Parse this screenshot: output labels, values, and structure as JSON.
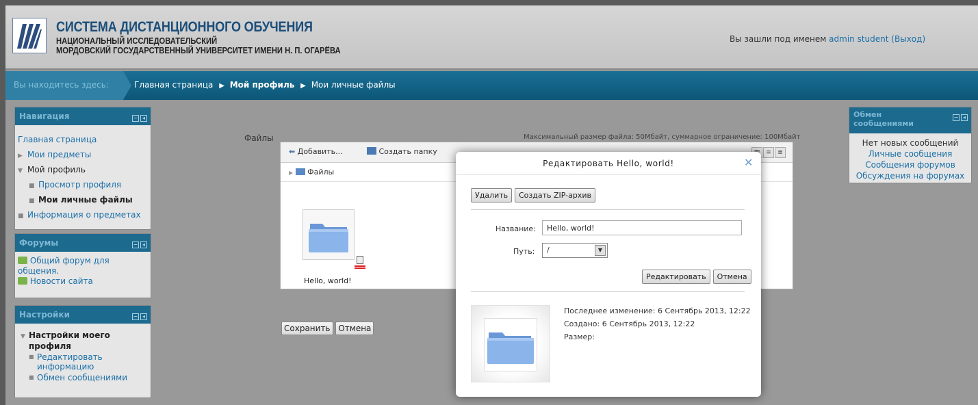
{
  "header": {
    "title": "СИСТЕМА ДИСТАНЦИОННОГО ОБУЧЕНИЯ",
    "subtitle1": "НАЦИОНАЛЬНЫЙ ИССЛЕДОВАТЕЛЬСКИЙ",
    "subtitle2": "МОРДОВСКИЙ ГОСУДАРСТВЕННЫЙ УНИВЕРСИТЕТ ИМЕНИ Н. П. ОГАРЁВА",
    "login_prefix": "Вы зашли под именем",
    "login_user": "admin student",
    "logout_open": "(",
    "logout": "Выход",
    "logout_close": ")"
  },
  "breadcrumb": {
    "here": "Вы находитесь здесь:",
    "items": [
      "Главная страница",
      "Мой профиль",
      "Мои личные файлы"
    ],
    "separator": "▶"
  },
  "navigation": {
    "title": "Навигация",
    "items": [
      {
        "label": "Главная страница",
        "marker": ""
      },
      {
        "label": "Мои предметы",
        "marker": "▶"
      },
      {
        "label": "Мой профиль",
        "marker": "▼"
      },
      {
        "label": "Просмотр профиля",
        "marker": "■"
      },
      {
        "label": "Мои личные файлы",
        "marker": "■"
      },
      {
        "label": "Информация о предметах",
        "marker": "■"
      }
    ]
  },
  "forums": {
    "title": "Форумы",
    "items": [
      "Общий форум для",
      "общения.",
      "Новости сайта"
    ]
  },
  "settings": {
    "title": "Настройки",
    "items": [
      "Настройки моего",
      "профиля",
      "Редактировать",
      "информацию",
      "Обмен сообщениями"
    ],
    "markers": [
      "▼",
      "■",
      "■"
    ]
  },
  "messages": {
    "title1": "Обмен",
    "title2": "сообщениями",
    "items": [
      "Нет новых сообщений",
      "Личные сообщения",
      "Сообщения форумов",
      "Обсуждения на форумах"
    ]
  },
  "files": {
    "label": "Файлы",
    "max_size": "Максимальный размер файла: 50Мбайт, суммарное ограничение: 100Мбайт",
    "toolbar": {
      "add": "Добавить...",
      "create_folder": "Создать папку"
    },
    "path": "Файлы",
    "file_name": "Hello, world!",
    "save": "Сохранить",
    "cancel": "Отмена"
  },
  "modal": {
    "title": "Редактировать Hello, world!",
    "delete": "Удалить",
    "zip": "Создать ZIP-архив",
    "name_label": "Название:",
    "name_value": "Hello, world!",
    "path_label": "Путь:",
    "path_value": "/",
    "edit": "Редактировать",
    "cancel": "Отмена",
    "modified": "Последнее изменение: 6 Сентябрь 2013, 12:22",
    "created": "Создано: 6 Сентябрь 2013, 12:22",
    "size": "Размер:"
  },
  "colors": {
    "header_title": "#1c4e7a",
    "navbar": "#0c5677",
    "link": "#1a6fa8",
    "block_head": "#1d6a8f"
  }
}
